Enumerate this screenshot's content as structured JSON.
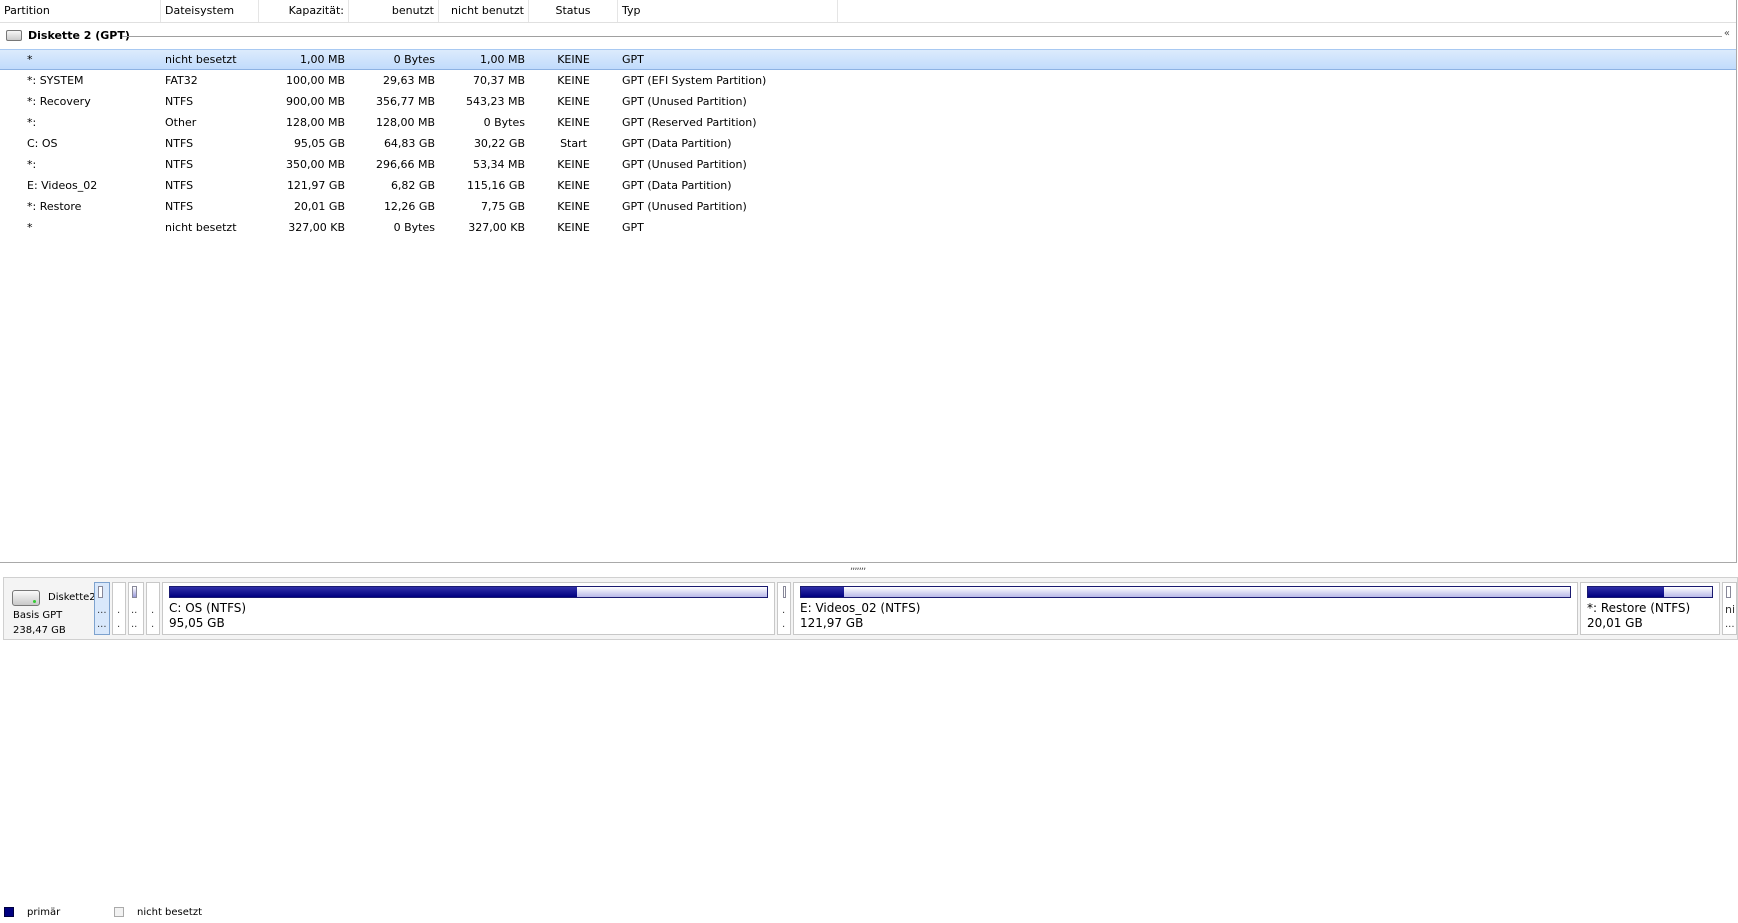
{
  "columns": {
    "partition": "Partition",
    "filesystem": "Dateisystem",
    "capacity": "Kapazität:",
    "used": "benutzt",
    "unused": "nicht benutzt",
    "status": "Status",
    "type": "Typ"
  },
  "group": {
    "title": "Diskette 2 (GPT)",
    "collapse_glyph": "«"
  },
  "rows": [
    {
      "partition": "*",
      "fs": "nicht besetzt",
      "capacity": "1,00 MB",
      "used": "0 Bytes",
      "unused": "1,00 MB",
      "status": "KEINE",
      "type": "GPT"
    },
    {
      "partition": "*: SYSTEM",
      "fs": "FAT32",
      "capacity": "100,00 MB",
      "used": "29,63 MB",
      "unused": "70,37 MB",
      "status": "KEINE",
      "type": "GPT (EFI System Partition)"
    },
    {
      "partition": "*: Recovery",
      "fs": "NTFS",
      "capacity": "900,00 MB",
      "used": "356,77 MB",
      "unused": "543,23 MB",
      "status": "KEINE",
      "type": "GPT (Unused Partition)"
    },
    {
      "partition": "*:",
      "fs": "Other",
      "capacity": "128,00 MB",
      "used": "128,00 MB",
      "unused": "0 Bytes",
      "status": "KEINE",
      "type": "GPT (Reserved Partition)"
    },
    {
      "partition": "C: OS",
      "fs": "NTFS",
      "capacity": "95,05 GB",
      "used": "64,83 GB",
      "unused": "30,22 GB",
      "status": "Start",
      "type": "GPT (Data Partition)"
    },
    {
      "partition": "*:",
      "fs": "NTFS",
      "capacity": "350,00 MB",
      "used": "296,66 MB",
      "unused": "53,34 MB",
      "status": "KEINE",
      "type": "GPT (Unused Partition)"
    },
    {
      "partition": "E: Videos_02",
      "fs": "NTFS",
      "capacity": "121,97 GB",
      "used": "6,82 GB",
      "unused": "115,16 GB",
      "status": "KEINE",
      "type": "GPT (Data Partition)"
    },
    {
      "partition": "*: Restore",
      "fs": "NTFS",
      "capacity": "20,01 GB",
      "used": "12,26 GB",
      "unused": "7,75 GB",
      "status": "KEINE",
      "type": "GPT (Unused Partition)"
    },
    {
      "partition": "*",
      "fs": "nicht besetzt",
      "capacity": "327,00 KB",
      "used": "0 Bytes",
      "unused": "327,00 KB",
      "status": "KEINE",
      "type": "GPT"
    }
  ],
  "splitter": ",,,,,,,",
  "disk": {
    "name": "Diskette2",
    "kind": "Basis GPT",
    "size": "238,47 GB"
  },
  "segments": {
    "s1": {
      "l1": "...",
      "l2": "..."
    },
    "s2": {
      "l1": ".",
      "l2": "."
    },
    "s3": {
      "l1": "..",
      "l2": ".."
    },
    "s4": {
      "l1": ".",
      "l2": "."
    },
    "os": {
      "label": "C: OS (NTFS)",
      "size": "95,05 GB",
      "fill": 0.682
    },
    "s6": {
      "l1": ".",
      "l2": "."
    },
    "videos": {
      "label": "E: Videos_02 (NTFS)",
      "size": "121,97 GB",
      "fill": 0.056
    },
    "restore": {
      "label": "*: Restore (NTFS)",
      "size": "20,01 GB",
      "fill": 0.613
    },
    "last": {
      "l1": "ni..",
      "l2": "..."
    }
  },
  "legend": {
    "primary": "primär",
    "unallocated": "nicht besetzt",
    "primary_color": "#000080"
  }
}
